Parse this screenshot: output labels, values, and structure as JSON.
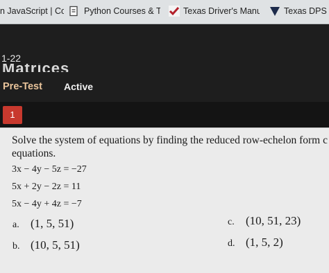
{
  "bookmarks": [
    {
      "label": "n JavaScript | Coc"
    },
    {
      "label": "Python Courses & Tu",
      "icon": "document-icon"
    },
    {
      "label": "Texas Driver's Manual",
      "icon": "checkmark-icon"
    },
    {
      "label": "Texas DPS -",
      "icon": "shield-icon"
    }
  ],
  "header": {
    "course_code": "1-22",
    "course_title": "Matrices",
    "tabs": [
      {
        "label": "Pre-Test",
        "color": "#e8c39a"
      },
      {
        "label": "Active"
      }
    ]
  },
  "question": {
    "number": "1",
    "prompt": "Solve the system of equations by finding the reduced row-echelon form c\nequations.",
    "equations": [
      "3x − 4y − 5z = −27",
      "5x + 2y − 2z = 11",
      "5x − 4y + 4z = −7"
    ],
    "answers": [
      {
        "letter": "a.",
        "value": "(1, 5, 51)"
      },
      {
        "letter": "b.",
        "value": "(10, 5, 51)"
      },
      {
        "letter": "c.",
        "value": "(10, 51, 23)"
      },
      {
        "letter": "d.",
        "value": "(1, 5, 2)"
      }
    ]
  },
  "colors": {
    "badge": "#c8392e",
    "header_bg": "#1e1e1e",
    "panel_bg": "#ebebeb"
  }
}
